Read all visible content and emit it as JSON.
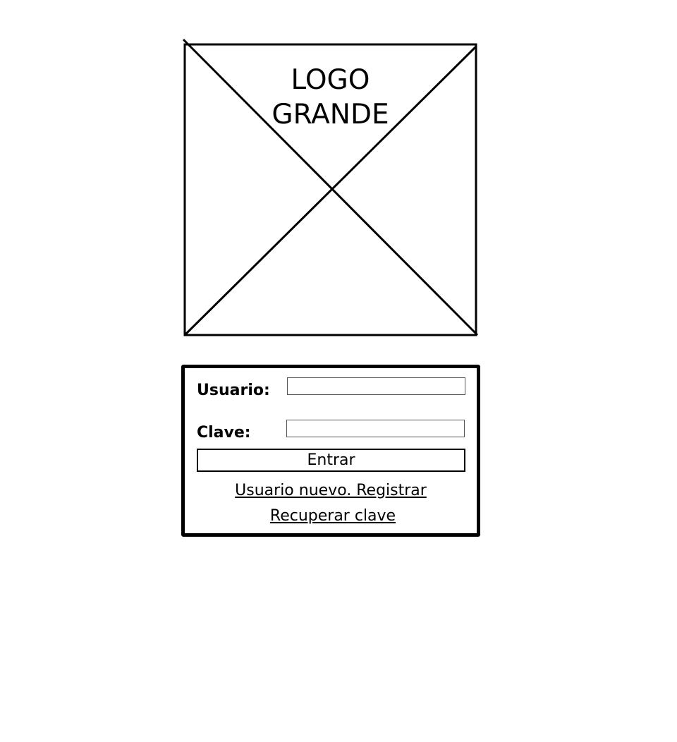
{
  "logo": {
    "line1": "LOGO",
    "line2": "GRANDE",
    "icon": "image-placeholder-icon"
  },
  "login": {
    "user_label": "Usuario:",
    "user_value": "",
    "password_label": "Clave:",
    "password_value": "",
    "submit_label": "Entrar",
    "register_link": "Usuario nuevo. Registrar",
    "recover_link": "Recuperar clave"
  },
  "colors": {
    "stroke": "#000000",
    "background": "#ffffff"
  }
}
